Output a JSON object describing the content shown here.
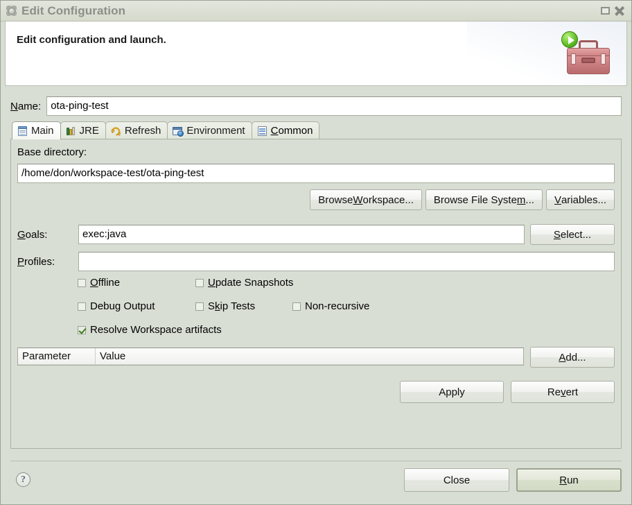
{
  "window": {
    "title": "Edit Configuration",
    "icon": "gear-icon",
    "maximize_label": "",
    "close_label": ""
  },
  "banner": {
    "message": "Edit configuration and launch.",
    "icon": "toolbox-with-run-icon"
  },
  "name_field": {
    "label": "Name:",
    "label_mnemonic": "N",
    "label_rest": "ame:",
    "value": "ota-ping-test"
  },
  "tabs": [
    {
      "label": "Main",
      "icon": "document-icon",
      "selected": true
    },
    {
      "label": "JRE",
      "icon": "books-icon",
      "selected": false
    },
    {
      "label": "Refresh",
      "icon": "refresh-icon",
      "selected": false
    },
    {
      "label": "Environment",
      "icon": "environment-icon",
      "selected": false
    },
    {
      "label": "Common",
      "icon": "list-icon",
      "selected": false
    }
  ],
  "main_tab": {
    "base_directory": {
      "label": "Base directory:",
      "value": "/home/don/workspace-test/ota-ping-test"
    },
    "browse_buttons": [
      {
        "pre": "Browse ",
        "mnemonic": "W",
        "post": "orkspace..."
      },
      {
        "pre": "Browse File Syste",
        "mnemonic": "m",
        "post": "..."
      },
      {
        "pre": "",
        "mnemonic": "V",
        "post": "ariables..."
      }
    ],
    "goals": {
      "label_mnemonic": "G",
      "label_rest": "oals:",
      "value": "exec:java",
      "button": {
        "pre": "",
        "mnemonic": "S",
        "post": "elect..."
      }
    },
    "profiles": {
      "label_mnemonic": "P",
      "label_rest": "rofiles:",
      "value": ""
    },
    "checkboxes": [
      {
        "pre": "",
        "mnemonic": "O",
        "post": "ffline",
        "checked": false
      },
      {
        "pre": "",
        "mnemonic": "U",
        "post": "pdate Snapshots",
        "checked": false
      },
      {
        "pre": "Debug Output",
        "mnemonic": "",
        "post": "",
        "checked": false
      },
      {
        "pre": "S",
        "mnemonic": "k",
        "post": "ip Tests",
        "checked": false
      },
      {
        "pre": "Non-recursive",
        "mnemonic": "",
        "post": "",
        "checked": false
      },
      {
        "pre": "Resolve Workspace artifacts",
        "mnemonic": "",
        "post": "",
        "checked": true
      }
    ],
    "parameter_table": {
      "columns": [
        "Parameter",
        "Value"
      ],
      "rows": []
    },
    "add_button": {
      "pre": "",
      "mnemonic": "A",
      "post": "dd..."
    },
    "apply_button": {
      "pre": "Apply",
      "mnemonic": "",
      "post": ""
    },
    "revert_button": {
      "pre": "Re",
      "mnemonic": "v",
      "post": "ert"
    }
  },
  "dialog_buttons": {
    "help": "?",
    "close": {
      "pre": "Close",
      "mnemonic": "",
      "post": ""
    },
    "run": {
      "pre": "",
      "mnemonic": "R",
      "post": "un"
    }
  },
  "colors": {
    "background": "#d9ded4",
    "titlebar": "#dce1d6",
    "field_background": "#ffffff",
    "default_button": "#dbe2ce",
    "accent_green": "#63c22a",
    "toolbox_red": "#c5797b"
  }
}
